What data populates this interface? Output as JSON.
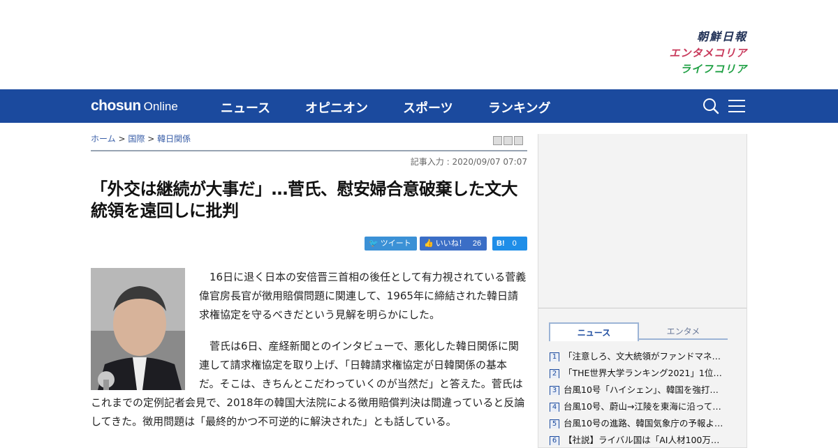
{
  "brand_links": {
    "chosun": "朝鮮日報",
    "enta": "エンタメコリア",
    "life": "ライフコリア"
  },
  "nav": {
    "logo_main": "chosun",
    "logo_sub": "Online",
    "items": [
      "ニュース",
      "オピニオン",
      "スポーツ",
      "ランキング"
    ],
    "search_icon": "search-icon",
    "menu_icon": "hamburger-icon"
  },
  "breadcrumb": {
    "home": "ホーム",
    "sep": ">",
    "l1": "国際",
    "l2": "韓日関係"
  },
  "article": {
    "posted": "記事入力 : 2020/09/07 07:07",
    "headline": "「外交は継続が大事だ」…菅氏、慰安婦合意破棄した文大統領を遠回しに批判",
    "share": {
      "twitter": "ツイート",
      "facebook": "いいね！",
      "facebook_count": "26",
      "hatena": "B!",
      "hatena_count": "0"
    },
    "paragraphs": [
      "16日に退く日本の安倍晋三首相の後任として有力視されている菅義偉官房長官が徴用賠償問題に関連して、1965年に締結された韓日請求権協定を守るべきだという見解を明らかにした。",
      "菅氏は6日、産経新聞とのインタビューで、悪化した韓日関係に関連して請求権協定を取り上げ、「日韓請求権協定が日韓関係の基本だ。そこは、きちんとこだわっていくのが当然だ」と答えた。菅氏はこれまでの定例記者会見で、2018年の韓国大法院による徴用賠償判決は間違っていると反論してきた。徴用問題は「最終的かつ不可逆的に解決された」とも話している。"
    ]
  },
  "sidebar": {
    "tabs": [
      "ニュース",
      "エンタメ"
    ],
    "ranking": [
      {
        "num": "1",
        "title": "「注意しろ、文大統領がファンドマネ…"
      },
      {
        "num": "2",
        "title": "「THE世界大学ランキング2021」1位…"
      },
      {
        "num": "3",
        "title": "台風10号「ハイシェン」、韓国を強打…"
      },
      {
        "num": "4",
        "title": "台風10号、蔚山→江陵を東海に沿って…"
      },
      {
        "num": "5",
        "title": "台風10号の進路、韓国気象庁の予報よ…"
      },
      {
        "num": "6",
        "title": "【社説】ライバル国は「AI人材100万…"
      }
    ]
  },
  "colors": {
    "nav_bg": "#1b4a9e",
    "twitter": "#3b91d6",
    "facebook": "#3b6ec6",
    "hatena": "#1f8ee8"
  }
}
